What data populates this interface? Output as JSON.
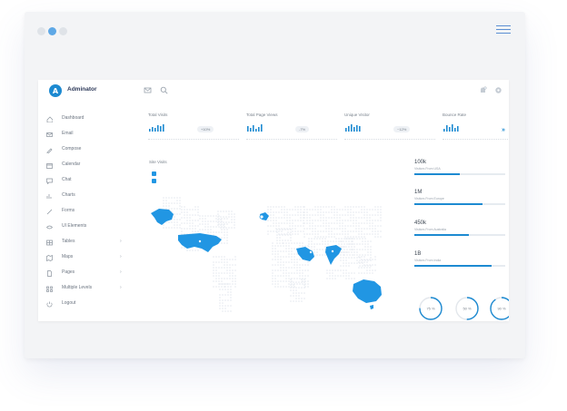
{
  "app": {
    "brand": "Adminator",
    "logo_letter": "A"
  },
  "colors": {
    "accent": "#1d8ad1",
    "map_fill": "#2196e3",
    "land": "#e3e8ee"
  },
  "sidebar": {
    "items": [
      {
        "label": "Dashboard",
        "icon": "home-icon",
        "chevron": ""
      },
      {
        "label": "Email",
        "icon": "mail-icon",
        "chevron": ""
      },
      {
        "label": "Compose",
        "icon": "pencil-icon",
        "chevron": ""
      },
      {
        "label": "Calendar",
        "icon": "calendar-icon",
        "chevron": ""
      },
      {
        "label": "Chat",
        "icon": "chat-icon",
        "chevron": ""
      },
      {
        "label": "Charts",
        "icon": "chart-icon",
        "chevron": ""
      },
      {
        "label": "Forms",
        "icon": "pen-icon",
        "chevron": ""
      },
      {
        "label": "UI Elements",
        "icon": "eye-icon",
        "chevron": ""
      },
      {
        "label": "Tables",
        "icon": "table-icon",
        "chevron": "›"
      },
      {
        "label": "Maps",
        "icon": "map-icon",
        "chevron": "›"
      },
      {
        "label": "Pages",
        "icon": "file-icon",
        "chevron": "›"
      },
      {
        "label": "Multiple Levels",
        "icon": "layers-icon",
        "chevron": "›"
      },
      {
        "label": "Logout",
        "icon": "power-icon",
        "chevron": ""
      }
    ]
  },
  "stats": [
    {
      "title": "Total Visits",
      "change": "+10%",
      "bars": [
        3,
        5,
        4,
        7,
        6,
        8
      ]
    },
    {
      "title": "Total Page Views",
      "change": "-7%",
      "bars": [
        6,
        4,
        7,
        3,
        5,
        8
      ]
    },
    {
      "title": "Unique Visitor",
      "change": "~12%",
      "bars": [
        4,
        6,
        8,
        5,
        7,
        6
      ]
    },
    {
      "title": "Bounce Rate",
      "change": "",
      "bars": [
        3,
        7,
        5,
        8,
        4,
        6
      ]
    }
  ],
  "more_label": "»",
  "site_visits": {
    "title": "Site Visits"
  },
  "right_stats": [
    {
      "value": "100k",
      "label": "Visitors From USA",
      "percent": 50
    },
    {
      "value": "1M",
      "label": "Visitors From Europe",
      "percent": 75
    },
    {
      "value": "450k",
      "label": "Visitors From Australia",
      "percent": 60
    },
    {
      "value": "1B",
      "label": "Visitors From India",
      "percent": 85
    }
  ],
  "gauges": [
    {
      "label": "75 %",
      "percent": 75
    },
    {
      "label": "50 %",
      "percent": 50
    },
    {
      "label": "90 %",
      "percent": 90
    }
  ]
}
